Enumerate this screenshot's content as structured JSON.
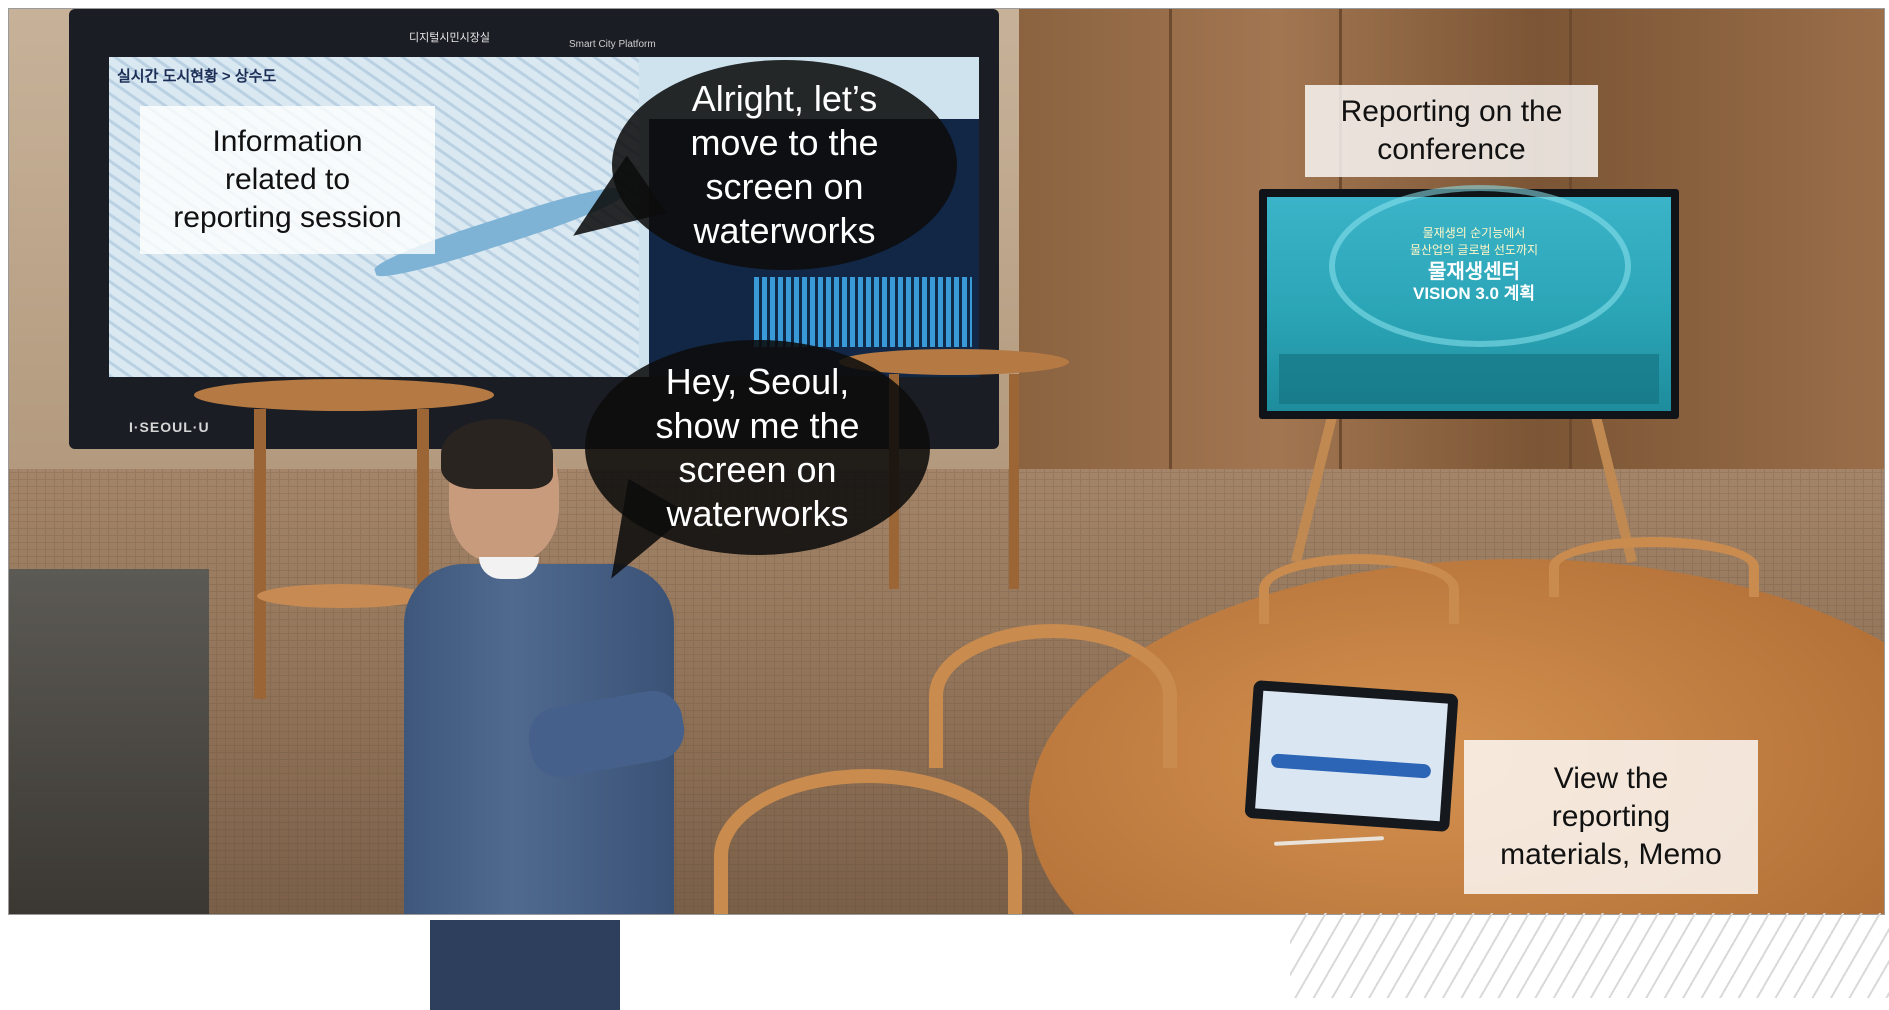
{
  "scene": {
    "video_wall": {
      "header": "디지털시민시장실",
      "header_sub": "Smart City Platform",
      "map_title": "실시간 도시현황 > 상수도",
      "logo": "I·SEOUL·U"
    },
    "monitor": {
      "line1": "물재생의 순기능에서\n물산업의 글로벌 선도까지",
      "line2": "물재생센터",
      "line3": "VISION 3.0 계획"
    }
  },
  "overlays": {
    "bubble_top": "Alright, let’s\nmove to the\nscreen on\nwaterworks",
    "bubble_bottom": "Hey, Seoul,\nshow me the\nscreen on\nwaterworks",
    "label_info": "Information\nrelated to\nreporting session",
    "label_conference": "Reporting on the\nconference",
    "label_materials": "View the\nreporting\nmaterials, Memo"
  },
  "colors": {
    "bubble": "#0c0c0c",
    "label_box": "#ffffff",
    "screen_teal": "#2aa5b6",
    "suit": "#4a6388"
  }
}
